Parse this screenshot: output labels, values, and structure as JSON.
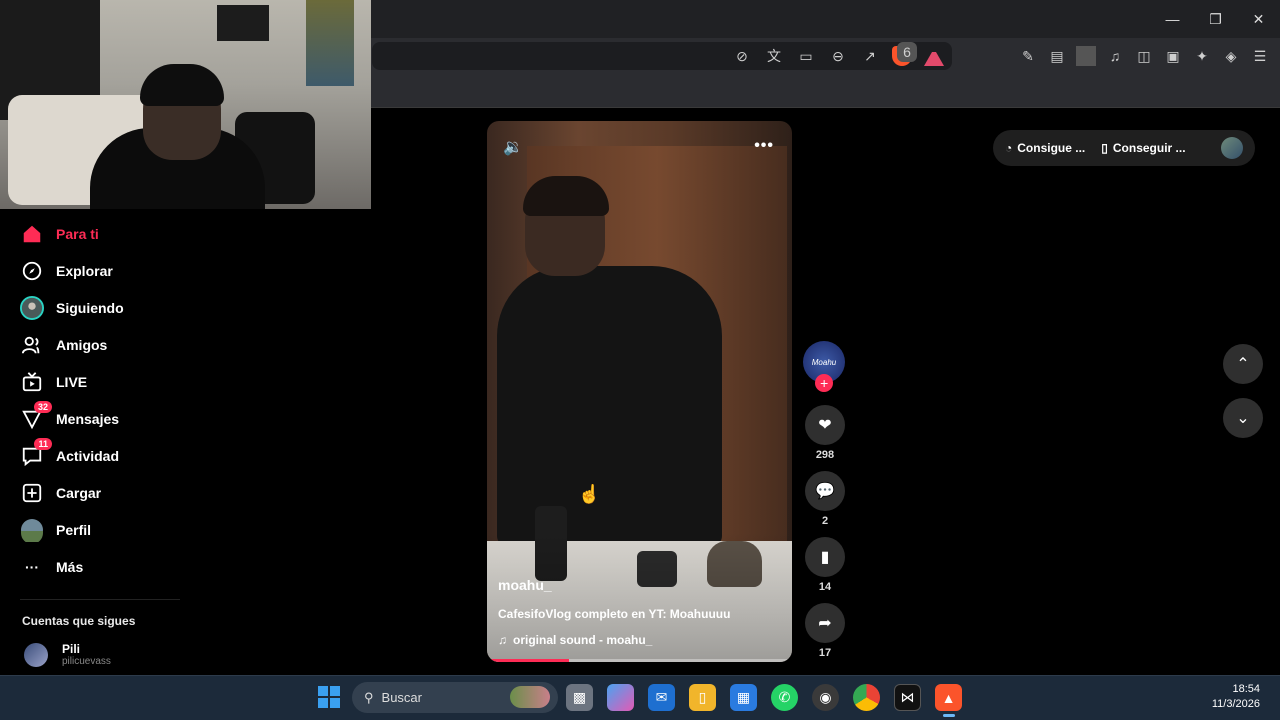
{
  "browser": {
    "window_controls": [
      "minimize",
      "restore",
      "close"
    ],
    "url_icons": [
      "no-sound-icon",
      "translate-icon",
      "cast-icon",
      "zoom-out-icon",
      "share-icon",
      "brave-shield-icon",
      "brave-rewards-icon"
    ],
    "shield_count": "6",
    "toolbar_icons": [
      "extensions-icon",
      "reader-icon",
      "media-icon",
      "sidebar-icon",
      "wallet-icon",
      "leo-ai-icon",
      "vpn-icon",
      "menu-icon"
    ]
  },
  "sidebar": {
    "items": [
      {
        "label": "Para ti",
        "icon": "home-icon",
        "active": true,
        "badge": ""
      },
      {
        "label": "Explorar",
        "icon": "compass-icon",
        "active": false,
        "badge": ""
      },
      {
        "label": "Siguiendo",
        "icon": "following-avatar-icon",
        "active": false,
        "badge": ""
      },
      {
        "label": "Amigos",
        "icon": "friends-icon",
        "active": false,
        "badge": ""
      },
      {
        "label": "LIVE",
        "icon": "live-tv-icon",
        "active": false,
        "badge": ""
      },
      {
        "label": "Mensajes",
        "icon": "send-icon",
        "active": false,
        "badge": "32"
      },
      {
        "label": "Actividad",
        "icon": "activity-icon",
        "active": false,
        "badge": "11"
      },
      {
        "label": "Cargar",
        "icon": "upload-icon",
        "active": false,
        "badge": ""
      },
      {
        "label": "Perfil",
        "icon": "profile-avatar-icon",
        "active": false,
        "badge": ""
      },
      {
        "label": "Más",
        "icon": "more-icon",
        "active": false,
        "badge": ""
      }
    ],
    "following_title": "Cuentas que sigues",
    "following": [
      {
        "name": "Pili",
        "handle": "pilicuevass"
      }
    ]
  },
  "video": {
    "username": "moahu_",
    "caption": "CafesifoVlog completo en YT: Moahuuuu",
    "sound": "original sound - moahu_",
    "progress": 0.27
  },
  "actions": {
    "likes": "298",
    "comments": "2",
    "saves": "14",
    "shares": "17",
    "creator_mark": "Moahu"
  },
  "top_right": {
    "get_coins": "Consigue ...",
    "get_app": "Conseguir ..."
  },
  "taskbar": {
    "search_placeholder": "Buscar",
    "time": "18:54",
    "date": "11/3/2026"
  }
}
